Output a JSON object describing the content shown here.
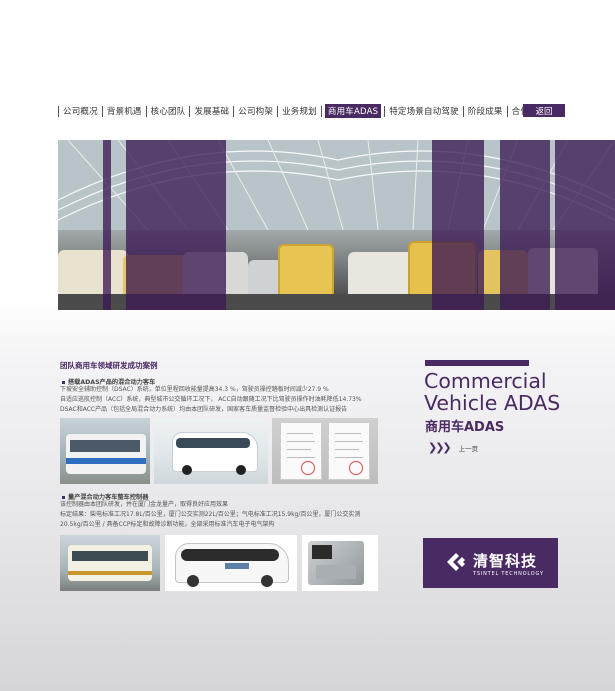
{
  "nav": {
    "items": [
      "公司概况",
      "背景机遇",
      "核心团队",
      "发展基础",
      "公司构架",
      "业务规划",
      "商用车ADAS",
      "特定场景自动驾驶",
      "阶段成果",
      "合作伙伴"
    ],
    "active_index": 6,
    "back_label": "返回"
  },
  "content": {
    "section_title": "团队商用车领域研发成功案例",
    "case1": {
      "title": "搭载ADAS产品的混合动力客车",
      "lines": [
        "下坡安全辅助控制（DSAC）系统，单位里程回收能量提高34.3 %，驾驶员操控踏板时间减少27.9 %",
        "自适应巡航控制（ACC）系统，典型城市公交循环工况下， ACC自动跟随工况下比驾驶员操作时油耗降低14.73%",
        "DSAC和ACC产品（包括全局混合动力系统）均由本团队研发，国家客车质量监督检验中心出具检测认证报告"
      ]
    },
    "case2": {
      "title": "量产混合动力客车整车控制器",
      "lines": [
        "该控制器由本团队研发，并在厦门金龙量产，取得良好应用效果",
        "标定结果：柴电标准工况17.8L/百公里，厦门公交实测22L/百公里；气电标准工况15.9kg/百公里，厦门公交实测",
        "20.5kg/百公里  /   具备CCP标定和故障诊断功能，全部采用标准汽车电子电气架构"
      ]
    }
  },
  "right": {
    "title_en_line1": "Commercial",
    "title_en_line2": "Vehicle ADAS",
    "title_cn": "商用车ADAS",
    "prev_arrows": "❯❯❯",
    "prev_label": "上一页",
    "logo_cn": "清智科技",
    "logo_en": "TSINTEL TECHNOLOGY"
  },
  "colors": {
    "accent": "#4a2a63",
    "text": "#444444"
  }
}
